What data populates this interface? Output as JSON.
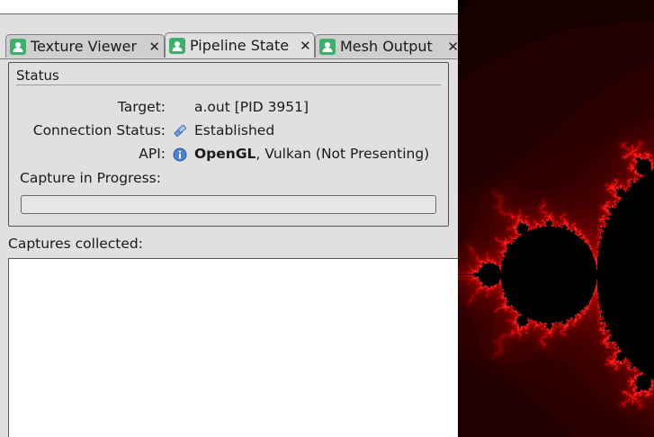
{
  "tabs": [
    {
      "label": "Texture Viewer",
      "close": "✕",
      "icon": "person-icon"
    },
    {
      "label": "Pipeline State",
      "close": "✕",
      "icon": "person-icon"
    },
    {
      "label": "Mesh Output",
      "close": "✕",
      "icon": "person-icon"
    }
  ],
  "status": {
    "title": "Status",
    "target_label": "Target:",
    "target_value": "a.out [PID 3951]",
    "connection_label": "Connection Status:",
    "connection_value": "Established",
    "connection_icon": "connect-icon",
    "api_label": "API:",
    "api_primary": "OpenGL",
    "api_rest": ", Vulkan (Not Presenting)",
    "api_icon": "info-icon",
    "capture_label": "Capture in Progress:",
    "progress": 0
  },
  "captures": {
    "label": "Captures collected:",
    "items": []
  },
  "colors": {
    "panel_bg": "#e0e0e0",
    "tab_icon": "#3db06b",
    "fractal_red": "#e01010",
    "background": "#000000"
  }
}
